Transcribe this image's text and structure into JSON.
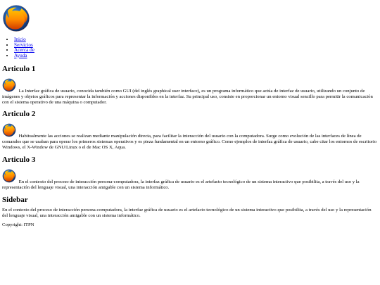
{
  "header": {
    "logo_icon": "firefox-logo-icon"
  },
  "nav": {
    "items": [
      "Inicio",
      "Servicios",
      "Acerca de",
      "Ayuda"
    ]
  },
  "articles": [
    {
      "title": "Articulo 1",
      "icon": "firefox-logo-icon",
      "text": "La Interfaz gráfica de usuario, conocida también como GUI (del inglés graphical user interface), es un programa informático que actúa de interfaz de usuario, utilizando un conjunto de imágenes y objetos gráficos para representar la información y acciones disponibles en la interfaz. Su principal uso, consiste en proporcionar un entorno visual sencillo para permitir la comunicación con el sistema operativo de una máquina o computador."
    },
    {
      "title": "Articulo 2",
      "icon": "firefox-logo-icon",
      "text": "Habitualmente las acciones se realizan mediante manipulación directa, para facilitar la interacción del usuario con la computadora. Surge como evolución de las interfaces de línea de comandos que se usaban para operar los primeros sistemas operativos y es pieza fundamental en un entorno gráfico. Como ejemplos de interfaz gráfica de usuario, cabe citar los entornos de escritorio Windows, el X-Window de GNU/Linux o el de Mac OS X, Aqua."
    },
    {
      "title": "Articulo 3",
      "icon": "firefox-logo-icon",
      "text": "En el contexto del proceso de interacción persona-computadora, la interfaz gráfica de usuario es el artefacto tecnológico de un sistema interactivo que posibilita, a través del uso y la representación del lenguaje visual, una interacción amigable con un sistema informático."
    }
  ],
  "sidebar": {
    "title": "Sidebar",
    "text": "En el contexto del proceso de interacción persona-computadora, la interfaz gráfica de usuario es el artefacto tecnológico de un sistema interactivo que posibilita, a través del uso y la representación del lenguaje visual, una interacción amigable con un sistema informático."
  },
  "footer": {
    "text": "Copyright: ITPN"
  },
  "colors": {
    "link": "#0000ee",
    "text": "#000000",
    "background": "#ffffff",
    "logo_orange": "#e66000",
    "logo_yellow": "#ffcb00",
    "logo_blue": "#1f5fb0"
  }
}
